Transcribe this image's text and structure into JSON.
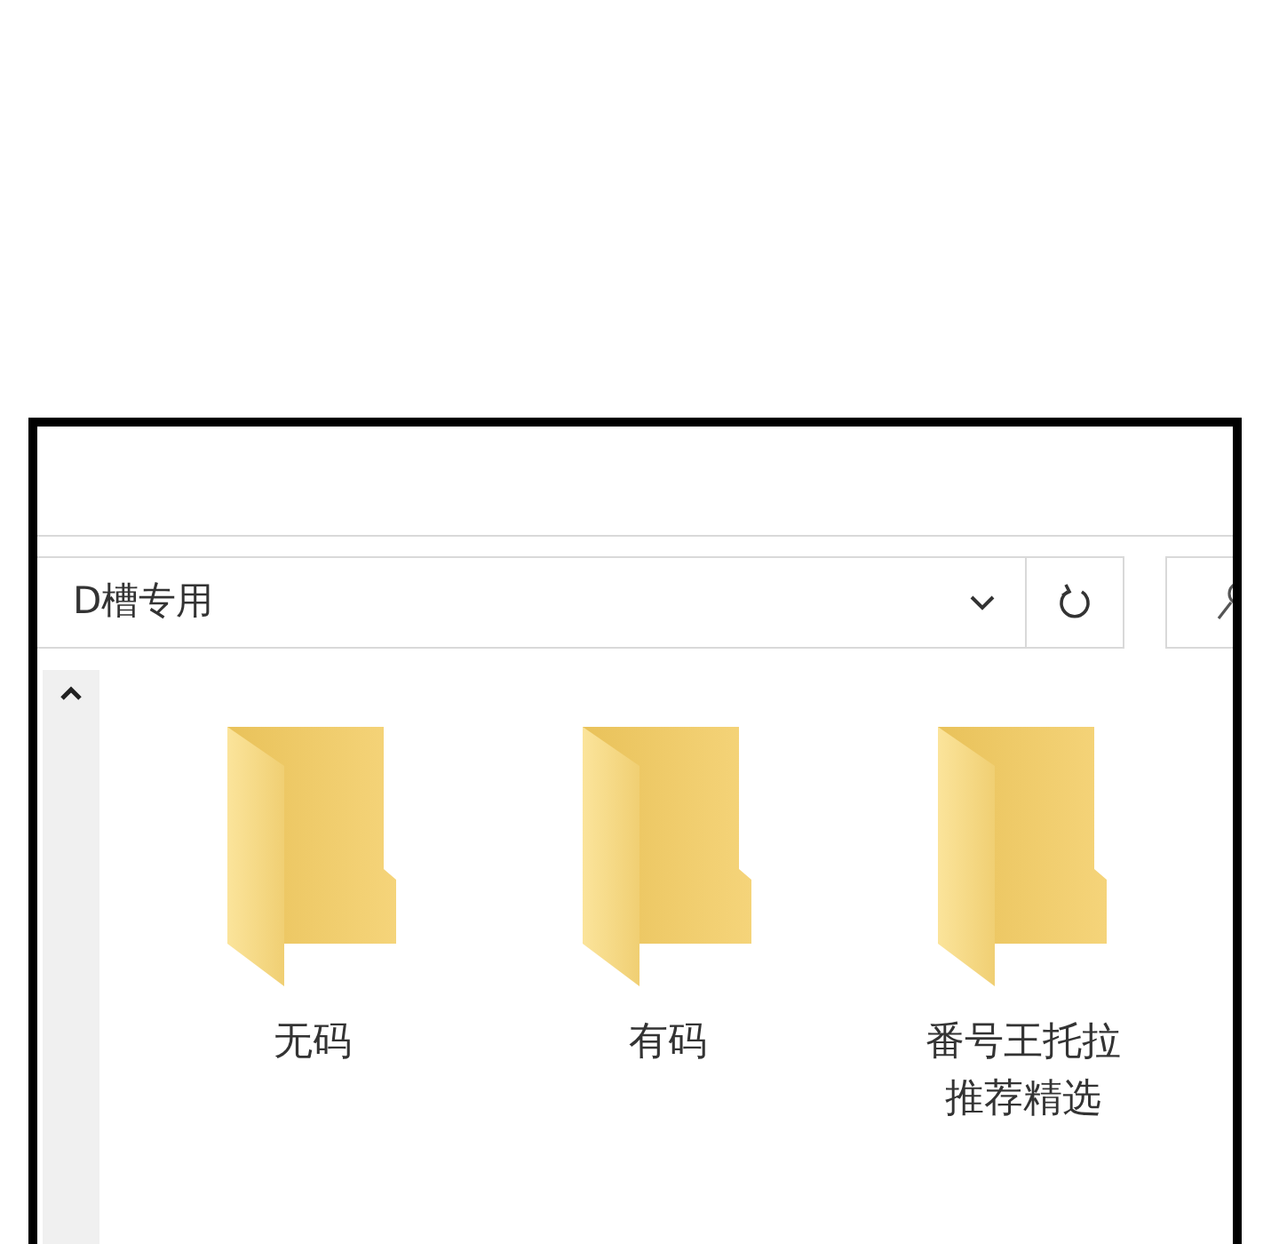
{
  "address_bar": {
    "path": "D槽专用"
  },
  "folders": [
    {
      "name": "无码"
    },
    {
      "name": "有码"
    },
    {
      "name": "番号王托拉推荐精选"
    }
  ]
}
